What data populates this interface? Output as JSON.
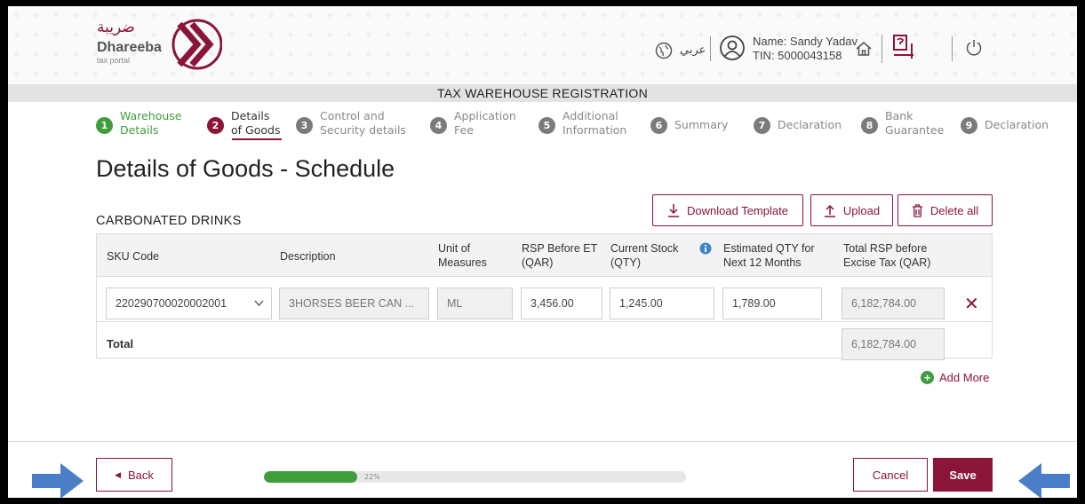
{
  "brand": {
    "logo_arabic": "ضريبة",
    "logo_name": "Dhareeba",
    "logo_sub": "tax portal"
  },
  "header": {
    "language_label": "عربي",
    "user_name": "Name: Sandy Yadav",
    "user_tin": "TIN: 5000043158"
  },
  "page_title_bar": "TAX WAREHOUSE REGISTRATION",
  "steps": [
    {
      "num": "1",
      "label": "Warehouse Details",
      "state": "done"
    },
    {
      "num": "2",
      "label": "Details of Goods",
      "state": "active"
    },
    {
      "num": "3",
      "label": "Control and Security details",
      "state": "pending"
    },
    {
      "num": "4",
      "label": "Application Fee",
      "state": "pending"
    },
    {
      "num": "5",
      "label": "Additional Information",
      "state": "pending"
    },
    {
      "num": "6",
      "label": "Summary",
      "state": "pending"
    },
    {
      "num": "7",
      "label": "Declaration",
      "state": "pending"
    },
    {
      "num": "8",
      "label": "Bank Guarantee",
      "state": "pending"
    },
    {
      "num": "9",
      "label": "Declaration",
      "state": "pending"
    }
  ],
  "heading": "Details of Goods - Schedule",
  "section": "CARBONATED DRINKS",
  "actions": {
    "download_template": "Download Template",
    "upload": "Upload",
    "delete_all": "Delete all"
  },
  "table": {
    "headers": {
      "sku": "SKU Code",
      "description": "Description",
      "uom": "Unit of Measures",
      "rsp": "RSP Before ET (QAR)",
      "stock": "Current Stock (QTY)",
      "est": "Estimated QTY for Next 12 Months",
      "total_rsp": "Total RSP before Excise Tax (QAR)"
    },
    "row": {
      "sku": "220290700020002001",
      "description": "3HORSES BEER CAN ...",
      "uom": "ML",
      "rsp": "3,456.00",
      "stock": "1,245.00",
      "est": "1,789.00",
      "total_rsp": "6,182,784.00"
    },
    "total_label": "Total",
    "total_value": "6,182,784.00"
  },
  "add_more": "Add More",
  "footer": {
    "back": "Back",
    "progress_label": "22%",
    "progress_value": 0.22,
    "cancel": "Cancel",
    "save": "Save"
  },
  "colors": {
    "brand": "#8a1538",
    "success": "#3f9e3b",
    "arrow": "#4a7fc8"
  }
}
